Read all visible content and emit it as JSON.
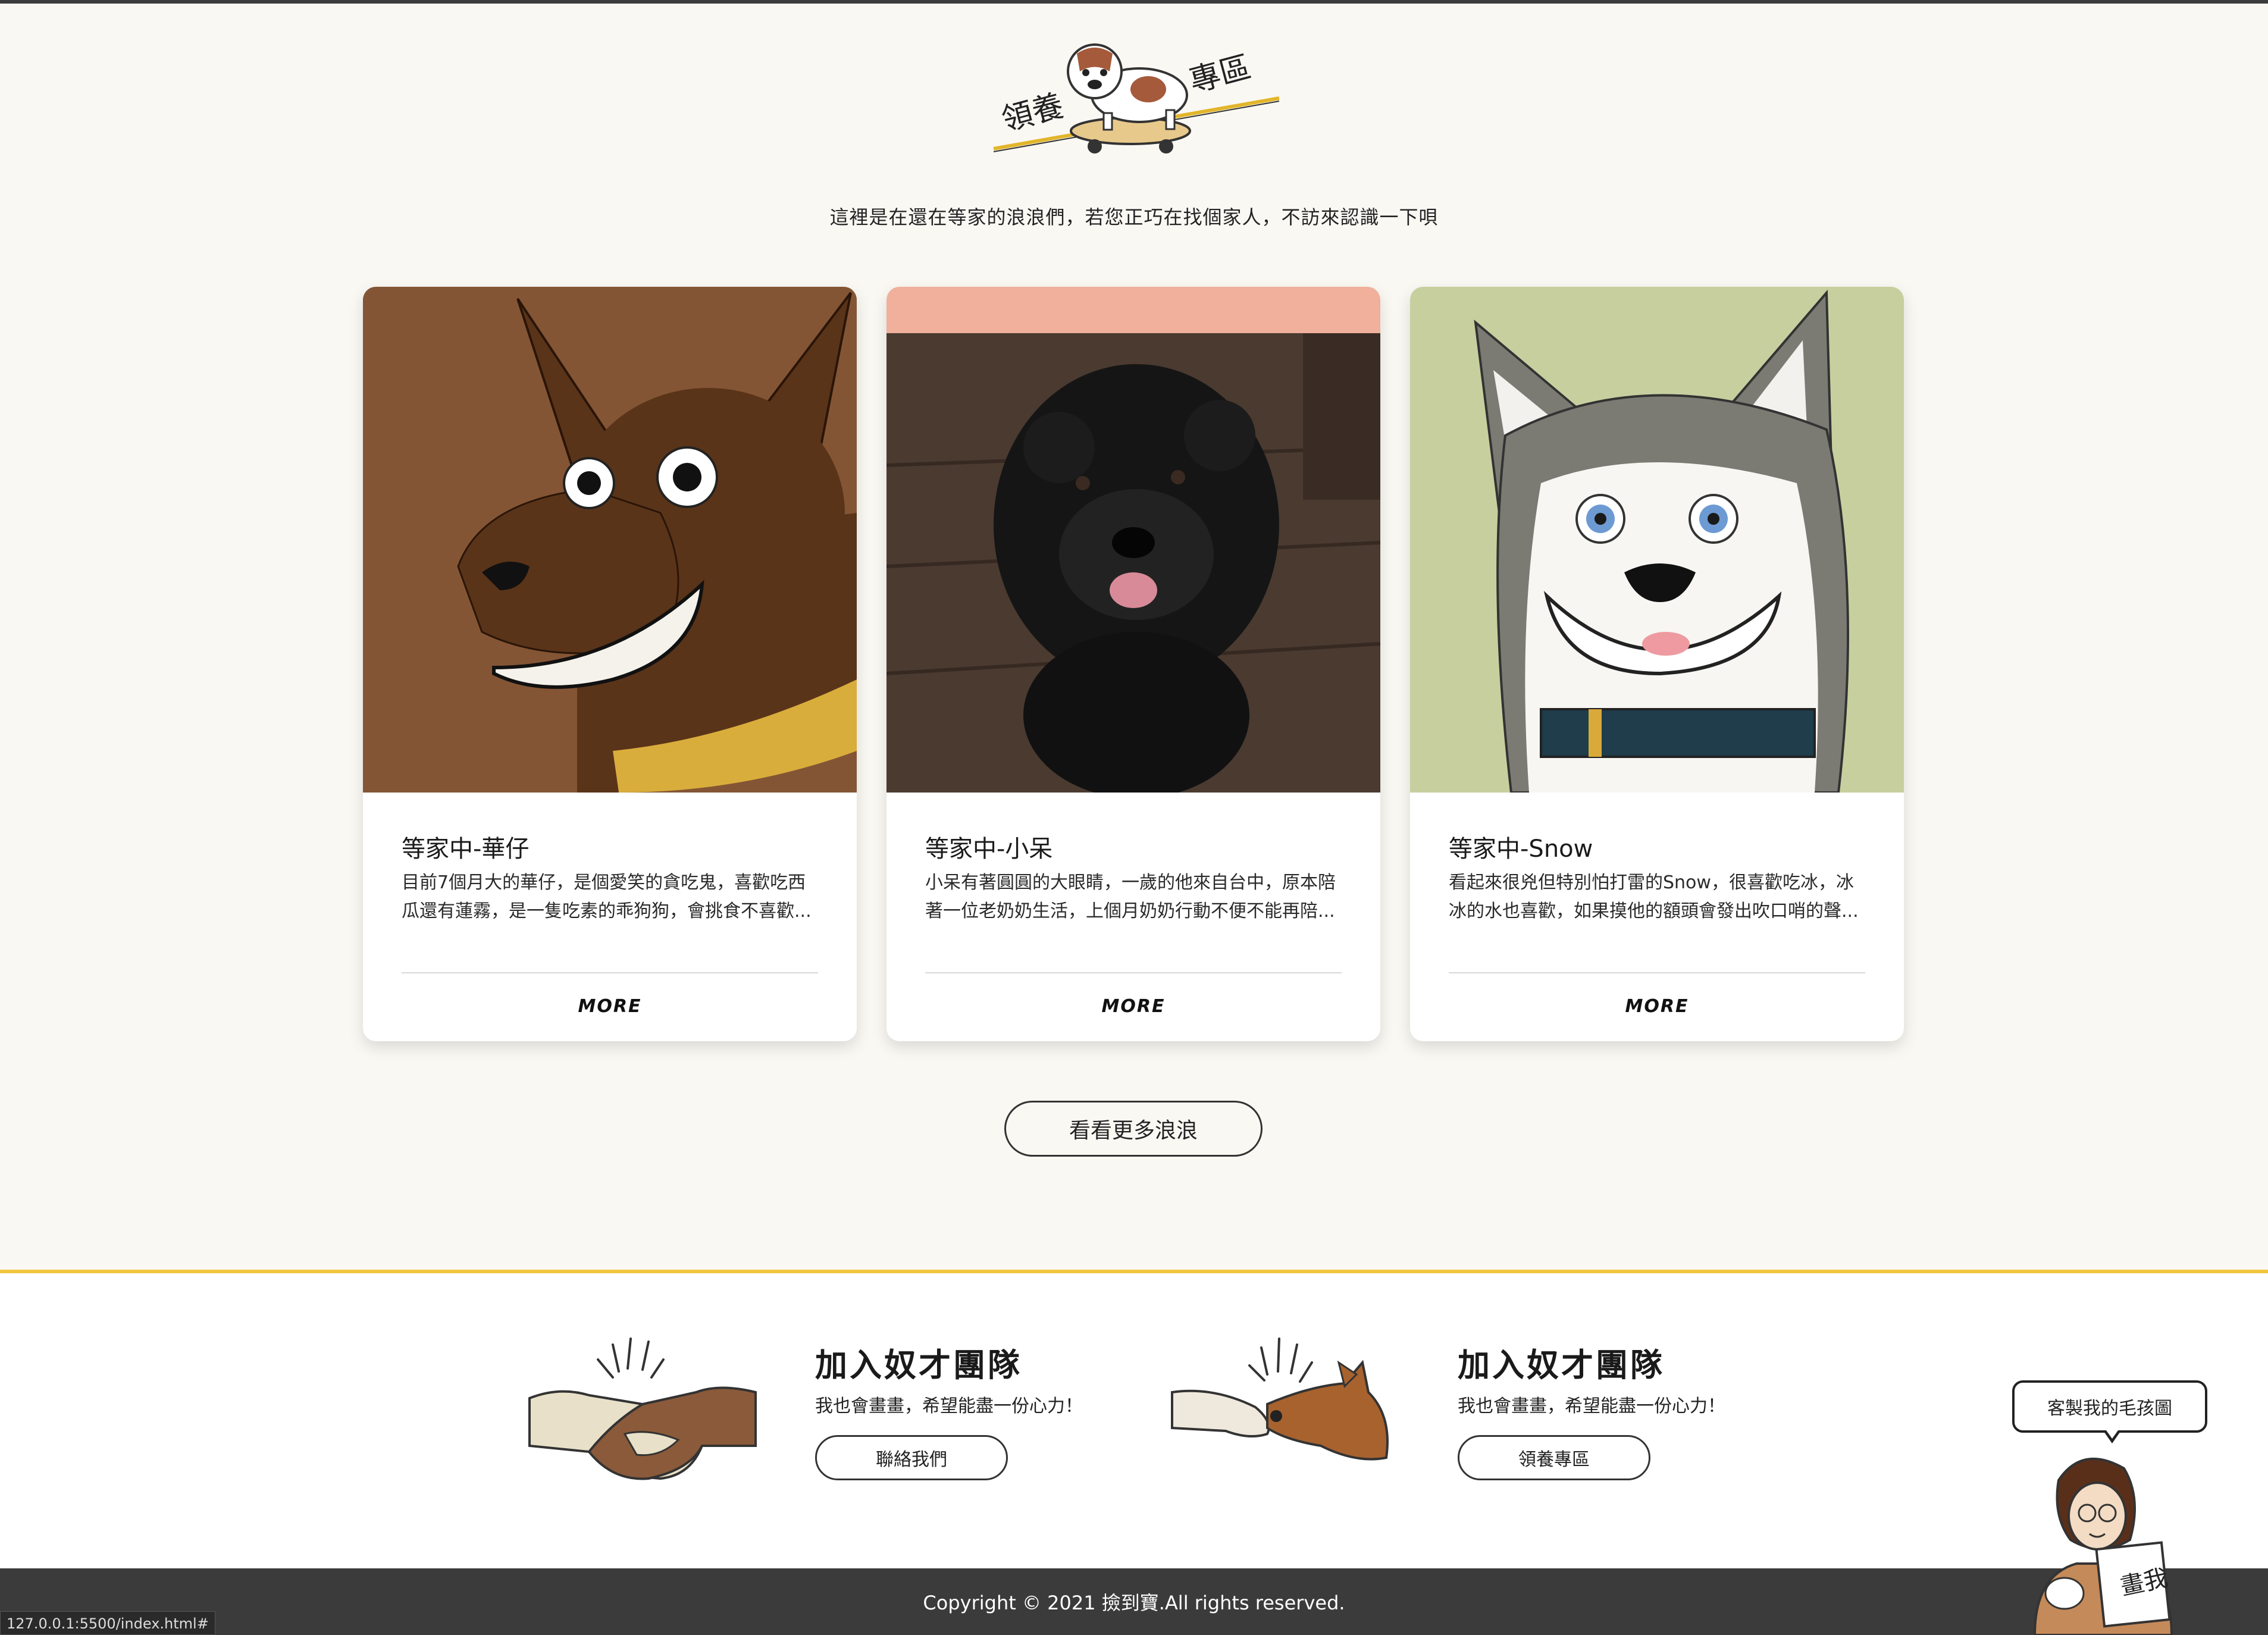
{
  "header": {
    "logo_left_text": "領養",
    "logo_right_text": "專區",
    "intro": "這裡是在還在等家的浪浪們，若您正巧在找個家人，不訪來認識一下唄"
  },
  "cards": [
    {
      "title": "等家中-華仔",
      "desc": "目前7個月大的華仔，是個愛笑的貪吃鬼，喜歡吃西瓜還有蓮霧，是一隻吃素的乖狗狗，會挑食不喜歡...",
      "more": "MORE"
    },
    {
      "title": "等家中-小呆",
      "desc": "小呆有著圓圓的大眼睛，一歲的他來自台中，原本陪著一位老奶奶生活，上個月奶奶行動不便不能再陪...",
      "more": "MORE"
    },
    {
      "title": "等家中-Snow",
      "desc": "看起來很兇但特別怕打雷的Snow，很喜歡吃冰，冰冰的水也喜歡，如果摸他的額頭會發出吹口哨的聲...",
      "more": "MORE"
    }
  ],
  "see_more_label": "看看更多浪浪",
  "join": [
    {
      "title": "加入奴才團隊",
      "subtitle": "我也會畫畫，希望能盡一份心力！",
      "button": "聯絡我們",
      "icon": "handshake-illustration"
    },
    {
      "title": "加入奴才團隊",
      "subtitle": "我也會畫畫，希望能盡一份心力！",
      "button": "領養專區",
      "icon": "hand-dog-illustration"
    }
  ],
  "custom_bubble": "客製我的毛孩圖",
  "custom_sign_text": "畫我",
  "footer": "Copyright © 2021 撿到寶.All rights reserved.",
  "status_url": "127.0.0.1:5500/index.html#",
  "colors": {
    "background": "#faf8f3",
    "accent_yellow": "#f0c63c",
    "footer": "#3b3b3b",
    "card1_bg": "#8a5a3a",
    "card2_top": "#f0b09c",
    "card3_bg": "#c7cf9f"
  }
}
